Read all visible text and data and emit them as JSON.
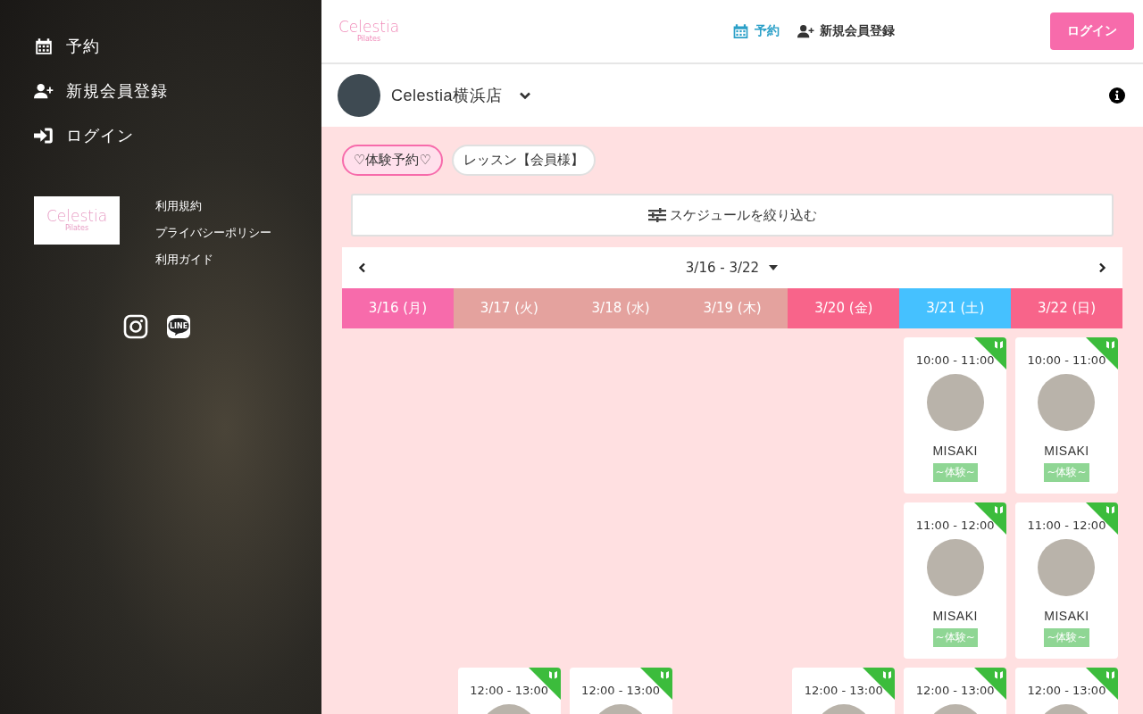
{
  "sidebar": {
    "menu": [
      {
        "kind": "calendar",
        "label": "予約"
      },
      {
        "kind": "user-plus",
        "label": "新規会員登録"
      },
      {
        "kind": "sign-in",
        "label": "ログイン"
      }
    ],
    "logo": {
      "name": "Celestia",
      "sub": "Pilates"
    },
    "links": [
      "利用規約",
      "プライバシーポリシー",
      "利用ガイド"
    ],
    "social": [
      {
        "kind": "instagram"
      },
      {
        "kind": "line",
        "label": "LINE"
      }
    ]
  },
  "header": {
    "logo": {
      "name": "Celestia",
      "sub": "Pilates"
    },
    "nav": [
      {
        "kind": "calendar",
        "label": "予約",
        "selected": true
      },
      {
        "kind": "user-plus",
        "label": "新規会員登録",
        "selected": false
      }
    ],
    "login_button": "ログイン"
  },
  "store": {
    "name": "Celestia横浜店"
  },
  "lesson_tabs": [
    {
      "label": "♡体験予約♡",
      "selected": true
    },
    {
      "label": "レッスン【会員様】",
      "selected": false
    }
  ],
  "filter_button": "スケジュールを絞り込む",
  "week": {
    "range": "3/16 - 3/22"
  },
  "days": [
    {
      "label": "3/16 (月)",
      "color": "#f76bab"
    },
    {
      "label": "3/17 (火)",
      "color": "#e4a29e"
    },
    {
      "label": "3/18 (水)",
      "color": "#e4a29e"
    },
    {
      "label": "3/19 (木)",
      "color": "#e4a29e"
    },
    {
      "label": "3/20 (金)",
      "color": "#f8648a"
    },
    {
      "label": "3/21 (土)",
      "color": "#45c1ff"
    },
    {
      "label": "3/22 (日)",
      "color": "#f8648a"
    }
  ],
  "schedule_rows": [
    {
      "cells": [
        {
          "kind": "empty"
        },
        {
          "kind": "empty"
        },
        {
          "kind": "empty"
        },
        {
          "kind": "empty"
        },
        {
          "kind": "empty"
        },
        {
          "kind": "lesson",
          "time": "10:00 - 11:00",
          "instructor": "MISAKI",
          "tag": "~体験~"
        },
        {
          "kind": "lesson",
          "time": "10:00 - 11:00",
          "instructor": "MISAKI",
          "tag": "~体験~"
        }
      ]
    },
    {
      "cells": [
        {
          "kind": "empty"
        },
        {
          "kind": "empty"
        },
        {
          "kind": "empty"
        },
        {
          "kind": "empty"
        },
        {
          "kind": "empty"
        },
        {
          "kind": "lesson",
          "time": "11:00 - 12:00",
          "instructor": "MISAKI",
          "tag": "~体験~"
        },
        {
          "kind": "lesson",
          "time": "11:00 - 12:00",
          "instructor": "MISAKI",
          "tag": "~体験~"
        }
      ]
    },
    {
      "cells": [
        {
          "kind": "empty"
        },
        {
          "kind": "lesson",
          "time": "12:00 - 13:00"
        },
        {
          "kind": "lesson",
          "time": "12:00 - 13:00"
        },
        {
          "kind": "empty"
        },
        {
          "kind": "lesson",
          "time": "12:00 - 13:00"
        },
        {
          "kind": "lesson",
          "time": "12:00 - 13:00"
        },
        {
          "kind": "lesson",
          "time": "12:00 - 13:00"
        }
      ]
    }
  ]
}
